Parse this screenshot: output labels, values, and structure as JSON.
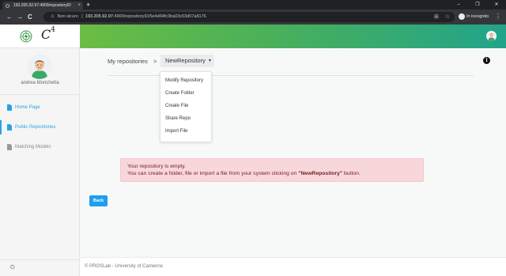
{
  "browser": {
    "tab_title": "193.205.92.97:4900/repositoryID",
    "tab_close": "×",
    "new_tab": "+",
    "window_controls": [
      "–",
      "❐",
      "✕"
    ],
    "nav": {
      "back": "←",
      "forward": "→",
      "reload": "C"
    },
    "address": {
      "security_label": "Non sicuro",
      "host": "193.205.92.97",
      "path": ":4900/repositoryID/5e4d64fc3ba03c03d07a8176"
    },
    "incognito_label": "In incognito",
    "menu": "⋮"
  },
  "sidebar": {
    "logo_letter": "C",
    "logo_sup": "4",
    "user_name": "andrea Morichetta",
    "items": [
      {
        "label": "Home Page",
        "state": "normal"
      },
      {
        "label": "Public Repositories",
        "state": "active"
      },
      {
        "label": "Matching Models",
        "state": "disabled"
      }
    ],
    "power_icon": "⏻"
  },
  "breadcrumb": {
    "root": "My repositories",
    "separator": ">",
    "current": "NewRepository",
    "caret": "▼"
  },
  "info_icon": "i",
  "dropdown_menu": [
    "Modify Repository",
    "Create Folder",
    "Create File",
    "Share Repo",
    "Import File"
  ],
  "alert": {
    "line1": "Your repository is empty.",
    "line2_prefix": "You can create a folder, file or import a file from your system clicking on ",
    "line2_bold": "\"NewRepository\"",
    "line2_suffix": " button."
  },
  "back_button": "Back",
  "footer": "© PROSLab - University of Camerino",
  "colors": {
    "accent": "#29a3e2",
    "button": "#1e9ff0",
    "header_start": "#6bbd44",
    "header_end": "#21a48a",
    "alert_bg": "#f8d7da"
  }
}
